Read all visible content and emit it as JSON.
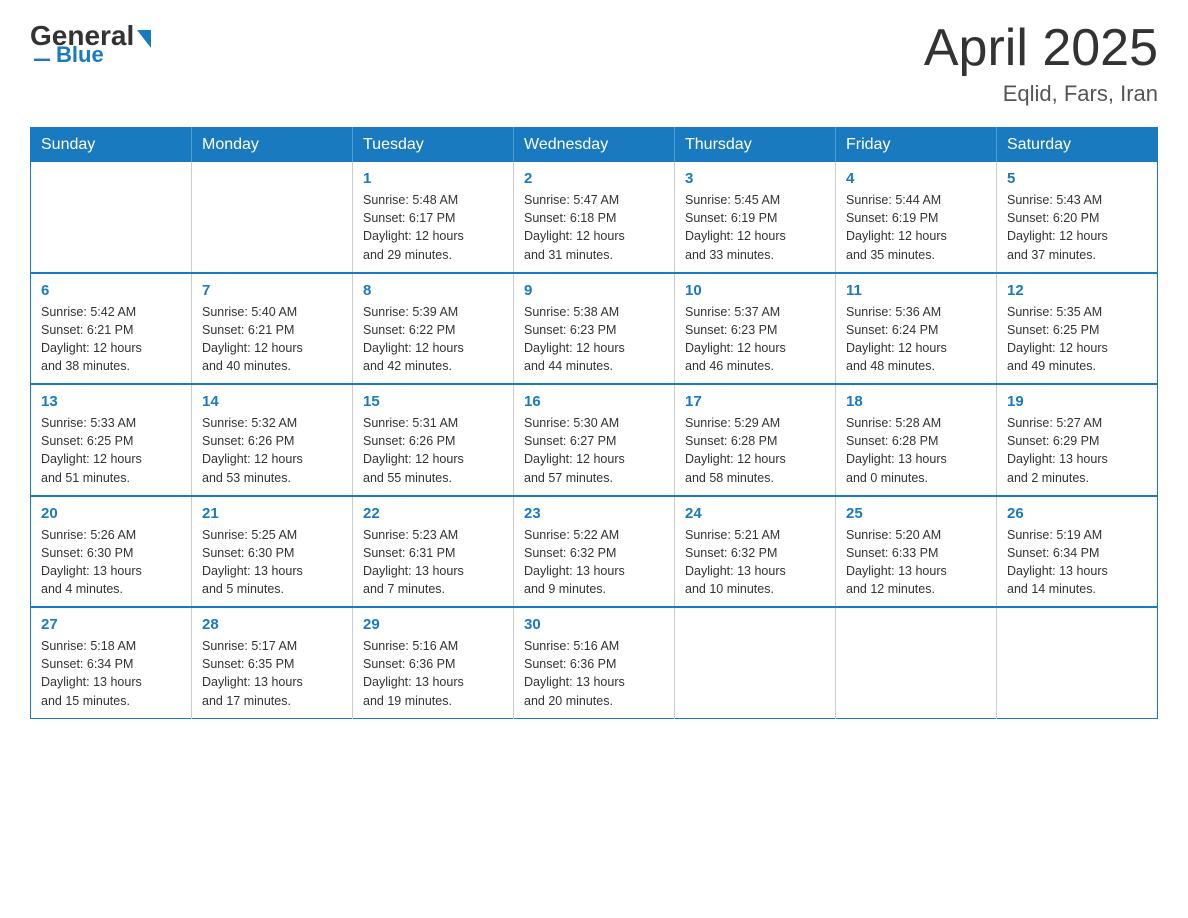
{
  "header": {
    "logo_general": "General",
    "logo_blue": "Blue",
    "month_title": "April 2025",
    "location": "Eqlid, Fars, Iran"
  },
  "days_of_week": [
    "Sunday",
    "Monday",
    "Tuesday",
    "Wednesday",
    "Thursday",
    "Friday",
    "Saturday"
  ],
  "weeks": [
    [
      {
        "num": "",
        "info": ""
      },
      {
        "num": "",
        "info": ""
      },
      {
        "num": "1",
        "info": "Sunrise: 5:48 AM\nSunset: 6:17 PM\nDaylight: 12 hours\nand 29 minutes."
      },
      {
        "num": "2",
        "info": "Sunrise: 5:47 AM\nSunset: 6:18 PM\nDaylight: 12 hours\nand 31 minutes."
      },
      {
        "num": "3",
        "info": "Sunrise: 5:45 AM\nSunset: 6:19 PM\nDaylight: 12 hours\nand 33 minutes."
      },
      {
        "num": "4",
        "info": "Sunrise: 5:44 AM\nSunset: 6:19 PM\nDaylight: 12 hours\nand 35 minutes."
      },
      {
        "num": "5",
        "info": "Sunrise: 5:43 AM\nSunset: 6:20 PM\nDaylight: 12 hours\nand 37 minutes."
      }
    ],
    [
      {
        "num": "6",
        "info": "Sunrise: 5:42 AM\nSunset: 6:21 PM\nDaylight: 12 hours\nand 38 minutes."
      },
      {
        "num": "7",
        "info": "Sunrise: 5:40 AM\nSunset: 6:21 PM\nDaylight: 12 hours\nand 40 minutes."
      },
      {
        "num": "8",
        "info": "Sunrise: 5:39 AM\nSunset: 6:22 PM\nDaylight: 12 hours\nand 42 minutes."
      },
      {
        "num": "9",
        "info": "Sunrise: 5:38 AM\nSunset: 6:23 PM\nDaylight: 12 hours\nand 44 minutes."
      },
      {
        "num": "10",
        "info": "Sunrise: 5:37 AM\nSunset: 6:23 PM\nDaylight: 12 hours\nand 46 minutes."
      },
      {
        "num": "11",
        "info": "Sunrise: 5:36 AM\nSunset: 6:24 PM\nDaylight: 12 hours\nand 48 minutes."
      },
      {
        "num": "12",
        "info": "Sunrise: 5:35 AM\nSunset: 6:25 PM\nDaylight: 12 hours\nand 49 minutes."
      }
    ],
    [
      {
        "num": "13",
        "info": "Sunrise: 5:33 AM\nSunset: 6:25 PM\nDaylight: 12 hours\nand 51 minutes."
      },
      {
        "num": "14",
        "info": "Sunrise: 5:32 AM\nSunset: 6:26 PM\nDaylight: 12 hours\nand 53 minutes."
      },
      {
        "num": "15",
        "info": "Sunrise: 5:31 AM\nSunset: 6:26 PM\nDaylight: 12 hours\nand 55 minutes."
      },
      {
        "num": "16",
        "info": "Sunrise: 5:30 AM\nSunset: 6:27 PM\nDaylight: 12 hours\nand 57 minutes."
      },
      {
        "num": "17",
        "info": "Sunrise: 5:29 AM\nSunset: 6:28 PM\nDaylight: 12 hours\nand 58 minutes."
      },
      {
        "num": "18",
        "info": "Sunrise: 5:28 AM\nSunset: 6:28 PM\nDaylight: 13 hours\nand 0 minutes."
      },
      {
        "num": "19",
        "info": "Sunrise: 5:27 AM\nSunset: 6:29 PM\nDaylight: 13 hours\nand 2 minutes."
      }
    ],
    [
      {
        "num": "20",
        "info": "Sunrise: 5:26 AM\nSunset: 6:30 PM\nDaylight: 13 hours\nand 4 minutes."
      },
      {
        "num": "21",
        "info": "Sunrise: 5:25 AM\nSunset: 6:30 PM\nDaylight: 13 hours\nand 5 minutes."
      },
      {
        "num": "22",
        "info": "Sunrise: 5:23 AM\nSunset: 6:31 PM\nDaylight: 13 hours\nand 7 minutes."
      },
      {
        "num": "23",
        "info": "Sunrise: 5:22 AM\nSunset: 6:32 PM\nDaylight: 13 hours\nand 9 minutes."
      },
      {
        "num": "24",
        "info": "Sunrise: 5:21 AM\nSunset: 6:32 PM\nDaylight: 13 hours\nand 10 minutes."
      },
      {
        "num": "25",
        "info": "Sunrise: 5:20 AM\nSunset: 6:33 PM\nDaylight: 13 hours\nand 12 minutes."
      },
      {
        "num": "26",
        "info": "Sunrise: 5:19 AM\nSunset: 6:34 PM\nDaylight: 13 hours\nand 14 minutes."
      }
    ],
    [
      {
        "num": "27",
        "info": "Sunrise: 5:18 AM\nSunset: 6:34 PM\nDaylight: 13 hours\nand 15 minutes."
      },
      {
        "num": "28",
        "info": "Sunrise: 5:17 AM\nSunset: 6:35 PM\nDaylight: 13 hours\nand 17 minutes."
      },
      {
        "num": "29",
        "info": "Sunrise: 5:16 AM\nSunset: 6:36 PM\nDaylight: 13 hours\nand 19 minutes."
      },
      {
        "num": "30",
        "info": "Sunrise: 5:16 AM\nSunset: 6:36 PM\nDaylight: 13 hours\nand 20 minutes."
      },
      {
        "num": "",
        "info": ""
      },
      {
        "num": "",
        "info": ""
      },
      {
        "num": "",
        "info": ""
      }
    ]
  ]
}
